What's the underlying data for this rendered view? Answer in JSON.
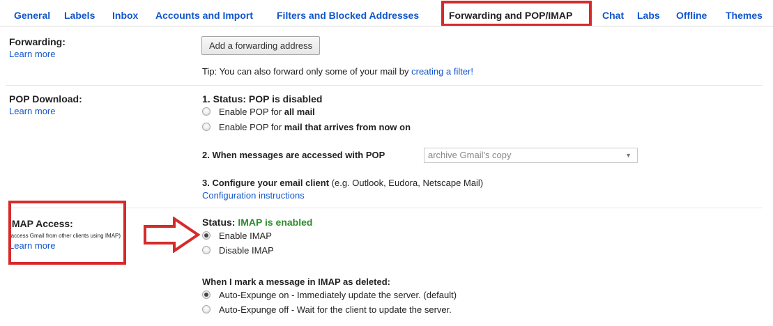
{
  "tabs": [
    {
      "label": "General"
    },
    {
      "label": "Labels"
    },
    {
      "label": "Inbox"
    },
    {
      "label": "Accounts and Import"
    },
    {
      "label": "Filters and Blocked Addresses"
    },
    {
      "label": "Forwarding and POP/IMAP"
    },
    {
      "label": "Chat"
    },
    {
      "label": "Labs"
    },
    {
      "label": "Offline"
    },
    {
      "label": "Themes"
    }
  ],
  "active_tab": "Forwarding and POP/IMAP",
  "colors": {
    "link": "#1155cc",
    "highlight": "#d72a2a",
    "enabled_status": "#2e8b2e"
  },
  "forwarding": {
    "title": "Forwarding:",
    "learn_more": "Learn more",
    "add_button": "Add a forwarding address",
    "tip_prefix": "Tip: You can also forward only some of your mail by ",
    "tip_link": "creating a filter!"
  },
  "pop": {
    "title": "POP Download:",
    "learn_more": "Learn more",
    "status_label": "1. Status: POP is disabled",
    "option_all_prefix": "Enable POP for ",
    "option_all_bold": "all mail",
    "option_now_prefix": "Enable POP for ",
    "option_now_bold": "mail that arrives from now on",
    "access_label": "2. When messages are accessed with POP",
    "access_select_value": "archive Gmail's copy",
    "configure_bold": "3. Configure your email client",
    "configure_rest": " (e.g. Outlook, Eudora, Netscape Mail)",
    "config_link": "Configuration instructions"
  },
  "imap": {
    "title": "IMAP Access:",
    "subtitle": "(access Gmail from other clients using IMAP)",
    "learn_more": "Learn more",
    "status_label": "Status: ",
    "status_value": "IMAP is enabled",
    "enable_label": "Enable IMAP",
    "disable_label": "Disable IMAP",
    "selected": "Enable IMAP",
    "delete_heading": "When I mark a message in IMAP as deleted:",
    "expunge_on": "Auto-Expunge on - Immediately update the server. (default)",
    "expunge_off": "Auto-Expunge off - Wait for the client to update the server.",
    "expunge_selected": "Auto-Expunge on - Immediately update the server. (default)"
  }
}
